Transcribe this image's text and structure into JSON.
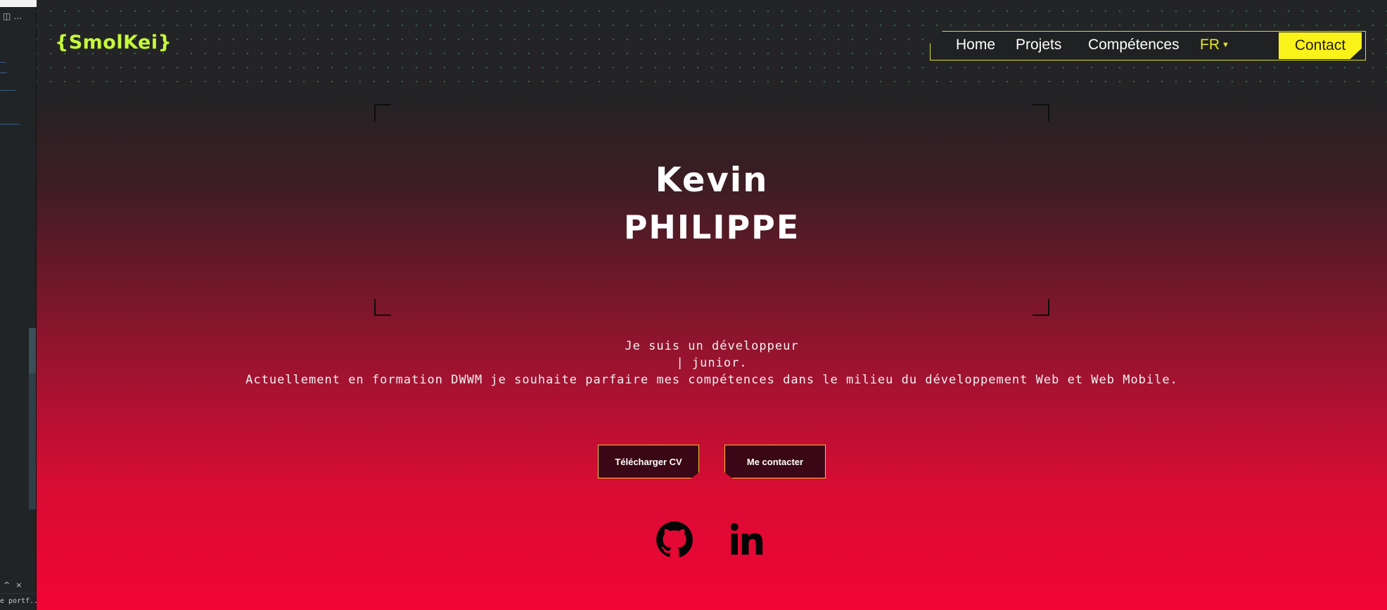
{
  "editor_sidebar": {
    "file_label": "e portf..."
  },
  "header": {
    "logo": "{SmolKei}",
    "nav": {
      "home": "Home",
      "projects": "Projets",
      "skills": "Compétences",
      "language": "FR",
      "contact": "Contact"
    },
    "theme_toggle_color": "#f1f016"
  },
  "hero": {
    "first_name": "Kevin",
    "last_name": "PHILIPPE",
    "intro_line1": "Je suis un développeur",
    "intro_line2": "| junior.",
    "intro_line3": "Actuellement en formation DWWM je souhaite parfaire mes compétences dans le milieu du développement Web et Web Mobile.",
    "download_cv": "Télécharger CV",
    "contact_me": "Me contacter"
  },
  "social": {
    "github_icon": "github-icon",
    "linkedin_icon": "linkedin-icon"
  },
  "colors": {
    "accent_green": "#c6f93a",
    "accent_yellow": "#faf31a",
    "gradient_bottom": "#f20436",
    "background_top": "#232426"
  }
}
